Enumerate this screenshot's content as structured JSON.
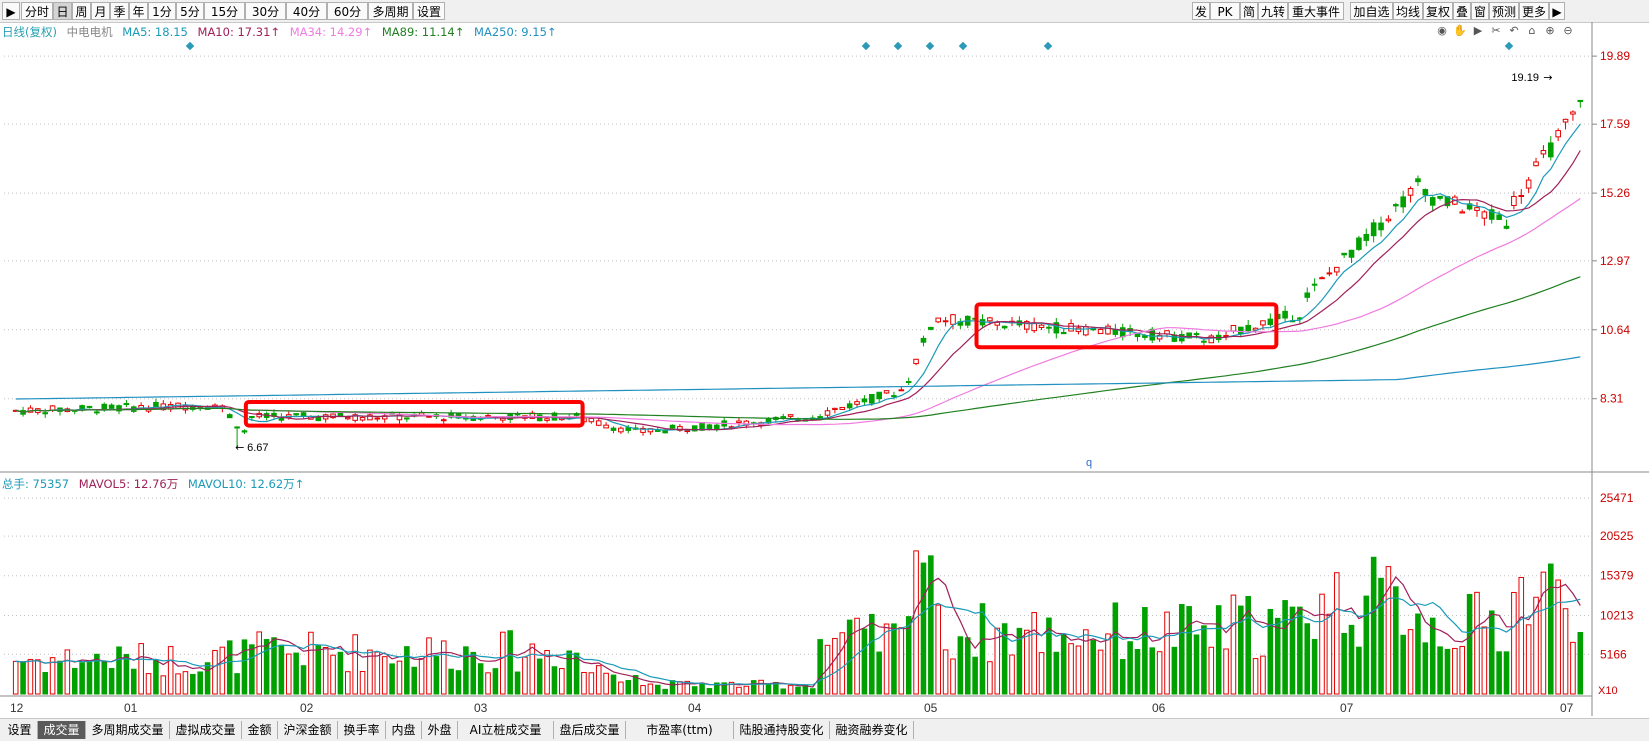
{
  "toolbar": {
    "left": [
      "分时",
      "日",
      "周",
      "月",
      "季",
      "年",
      "1分",
      "5分",
      "15分",
      "30分",
      "40分",
      "60分",
      "多周期",
      "设置"
    ],
    "selected": "日",
    "right": [
      "发",
      "PK",
      "简",
      "九转",
      "重大事件",
      "加自选",
      "均线",
      "复权",
      "叠",
      "窗",
      "预测",
      "更多"
    ]
  },
  "indicators": {
    "period_label": "日线(复权)",
    "stock_name": "中电电机",
    "ma5": "MA5: 18.15",
    "ma10": "MA10: 17.31↑",
    "ma34": "MA34: 14.29↑",
    "ma89": "MA89: 11.14↑",
    "ma250": "MA250: 9.15↑"
  },
  "volume_indicators": {
    "total": "总手: 75357",
    "mavol5": "MAVOL5: 12.76万",
    "mavol10": "MAVOL10: 12.62万↑"
  },
  "annotations": {
    "high_label": "19.19",
    "low_label": "6.67",
    "mid_marker": "q",
    "volume_unit": "X10"
  },
  "bottom_tabs": [
    "设置",
    "成交量",
    "多周期成交量",
    "虚拟成交量",
    "金额",
    "沪深金额",
    "换手率",
    "内盘",
    "外盘",
    "AI立桩成交量",
    "盘后成交量",
    "市盈率(ttm)",
    "陆股通持股变化",
    "融资融券变化"
  ],
  "bottom_selected": "成交量",
  "colors": {
    "up": "#e60000",
    "down": "#00a000",
    "ma5": "#1a9ab8",
    "ma10": "#a0205a",
    "ma34": "#f07ae0",
    "ma89": "#208020",
    "ma250": "#2090c0",
    "highlight_box": "#ff0000"
  },
  "chart_data": {
    "type": "candlestick",
    "price_axis_ticks": [
      "19.89",
      "17.59",
      "15.26",
      "12.97",
      "10.64",
      "8.31"
    ],
    "volume_axis_ticks": [
      "25471",
      "20525",
      "15379",
      "10213",
      "5166"
    ],
    "x_labels": [
      "12",
      "01",
      "02",
      "03",
      "04",
      "05",
      "06",
      "07",
      "07"
    ],
    "price_range": [
      5.9,
      20.3
    ],
    "volume_range": [
      0,
      26000
    ],
    "segments": [
      {
        "name": "pre",
        "start": 7.9,
        "end": 8.1,
        "n": 28,
        "vol": 4500
      },
      {
        "name": "dip",
        "start": 8.0,
        "end": 7.2,
        "n": 4,
        "vol": 5000
      },
      {
        "name": "box1",
        "start": 7.7,
        "end": 7.7,
        "n": 45,
        "vol": 5500
      },
      {
        "name": "down",
        "start": 7.6,
        "end": 7.2,
        "n": 8,
        "vol": 3000
      },
      {
        "name": "flat",
        "start": 7.2,
        "end": 7.7,
        "n": 24,
        "vol": 1200
      },
      {
        "name": "up1",
        "start": 7.8,
        "end": 8.6,
        "n": 12,
        "vol": 7000
      },
      {
        "name": "jump",
        "start": 9.0,
        "end": 10.8,
        "n": 4,
        "vol": 20000
      },
      {
        "name": "box2",
        "start": 11.0,
        "end": 10.3,
        "n": 40,
        "vol": 8000
      },
      {
        "name": "break",
        "start": 10.6,
        "end": 11.2,
        "n": 10,
        "vol": 9000
      },
      {
        "name": "rally",
        "start": 11.8,
        "end": 15.5,
        "n": 16,
        "vol": 12000
      },
      {
        "name": "pull",
        "start": 15.2,
        "end": 14.3,
        "n": 12,
        "vol": 9000
      },
      {
        "name": "top",
        "start": 15.0,
        "end": 18.2,
        "n": 10,
        "vol": 13000
      }
    ],
    "ma_endpoints": {
      "ma5": 18.15,
      "ma10": 17.31,
      "ma34": 14.29,
      "ma89": 11.14,
      "ma250": 9.15
    }
  }
}
